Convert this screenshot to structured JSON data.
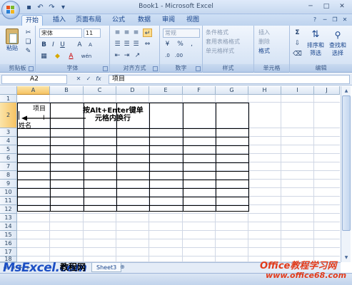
{
  "window": {
    "title": "Book1 - Microsoft Excel"
  },
  "qat": {
    "icons": [
      "save-icon",
      "undo-icon",
      "redo-icon",
      "dropdown-icon"
    ]
  },
  "tabs": [
    {
      "label": "开始",
      "active": true
    },
    {
      "label": "插入"
    },
    {
      "label": "页面布局"
    },
    {
      "label": "公式"
    },
    {
      "label": "数据"
    },
    {
      "label": "审阅"
    },
    {
      "label": "视图"
    }
  ],
  "ribbon": {
    "clipboard": {
      "paste_label": "粘贴",
      "group_label": "剪贴板"
    },
    "font": {
      "font_name": "宋体",
      "font_size": "11",
      "bold": "B",
      "italic": "I",
      "underline": "U",
      "grow": "A",
      "shrink": "A",
      "color_letter": "A",
      "phonetic": "wén",
      "group_label": "字体"
    },
    "alignment": {
      "group_label": "对齐方式"
    },
    "number": {
      "format": "常规",
      "percent": "%",
      "comma": ",",
      "group_label": "数字"
    },
    "styles": {
      "conditional": "条件格式",
      "table": "套用表格格式",
      "cell": "单元格样式",
      "group_label": "样式"
    },
    "cells": {
      "insert": "插入",
      "delete": "删除",
      "format": "格式",
      "group_label": "单元格"
    },
    "editing": {
      "sigma": "Σ",
      "sort_label": "排序和",
      "sort_label2": "筛选",
      "find_label": "查找和",
      "find_label2": "选择",
      "group_label": "编辑"
    }
  },
  "formula_bar": {
    "name_box": "A2",
    "fx": "fx",
    "content": "项目"
  },
  "grid": {
    "columns": [
      "A",
      "B",
      "C",
      "D",
      "E",
      "F",
      "G",
      "H",
      "I",
      "J"
    ],
    "rows": [
      "1",
      "2",
      "3",
      "4",
      "5",
      "6",
      "7",
      "8",
      "9",
      "10",
      "11",
      "12",
      "13",
      "14",
      "15",
      "16",
      "17",
      "18"
    ],
    "selected_column": "A",
    "selected_row": "2",
    "cell_a2_line1": "项目",
    "cell_a2_line2": "姓名",
    "annotation_line1": "按Alt+Enter键单",
    "annotation_line2": "元格内换行"
  },
  "sheets": {
    "tab_label": "Sheet3"
  },
  "watermark": {
    "left": "MsExcel.com",
    "left_cn": "教程网",
    "right": "Office教程学习网",
    "right_url": "www.office68.com"
  }
}
